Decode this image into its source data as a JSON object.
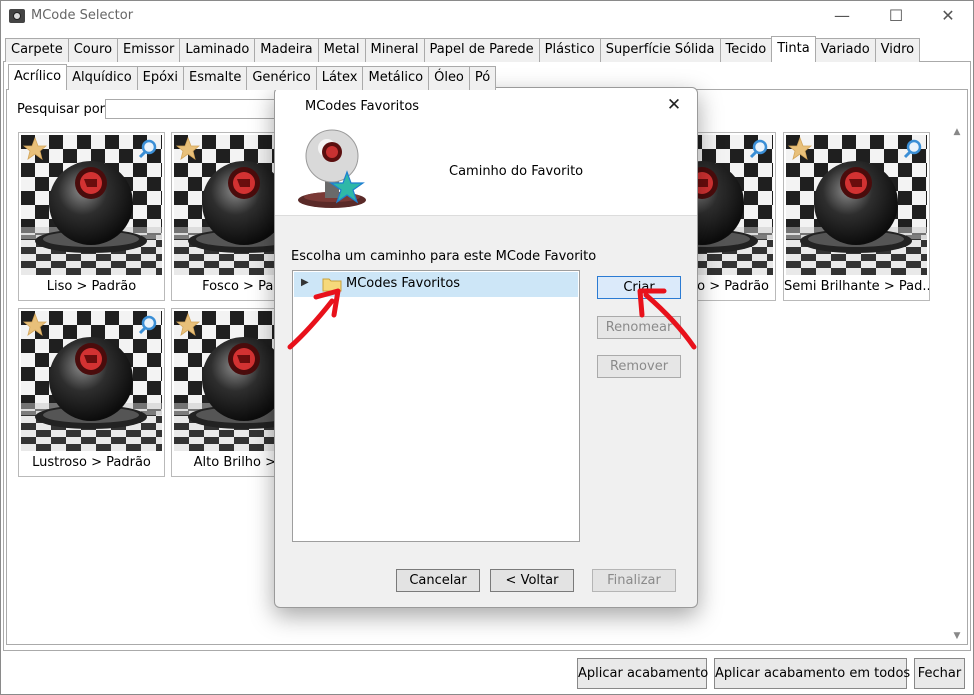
{
  "window": {
    "title": "MCode Selector",
    "controls": [
      "—",
      "☐",
      "✕"
    ]
  },
  "categories": {
    "tabs": [
      "Carpete",
      "Couro",
      "Emissor",
      "Laminado",
      "Madeira",
      "Metal",
      "Mineral",
      "Papel de Parede",
      "Plástico",
      "Superfície Sólida",
      "Tecido",
      "Tinta",
      "Variado",
      "Vidro"
    ],
    "active": "Tinta"
  },
  "subcategories": {
    "tabs": [
      "Acrílico",
      "Alquídico",
      "Epóxi",
      "Esmalte",
      "Genérico",
      "Látex",
      "Metálico",
      "Óleo",
      "Pó"
    ],
    "active": "Acrílico"
  },
  "search": {
    "label": "Pesquisar por:",
    "value": ""
  },
  "materials": [
    {
      "caption": "Liso > Padrão"
    },
    {
      "caption": "Fosco > Padr"
    },
    {
      "caption": "o > Padrão"
    },
    {
      "caption": "Semi Brilhante > Pad..."
    },
    {
      "caption": "Lustroso > Padrão"
    },
    {
      "caption": "Alto Brilho > Pa"
    }
  ],
  "footer": {
    "apply": "Aplicar acabamento",
    "apply_all": "Aplicar acabamento em todos",
    "close": "Fechar"
  },
  "dialog": {
    "title": "MCodes Favoritos",
    "close_glyph": "✕",
    "subtitle": "Caminho do Favorito",
    "choose_label": "Escolha um caminho para este MCode Favorito",
    "tree": {
      "expand_glyph": "▶",
      "root": "MCodes Favoritos"
    },
    "buttons": {
      "create": "Criar",
      "rename": "Renomear",
      "remove": "Remover",
      "cancel": "Cancelar",
      "back": "< Voltar",
      "finish": "Finalizar"
    }
  },
  "colors": {
    "selection": "#cde6f7",
    "primary_border": "#2b7bd3",
    "annotation_arrow": "#e8111b",
    "favorite_star": "#e8c07a"
  }
}
